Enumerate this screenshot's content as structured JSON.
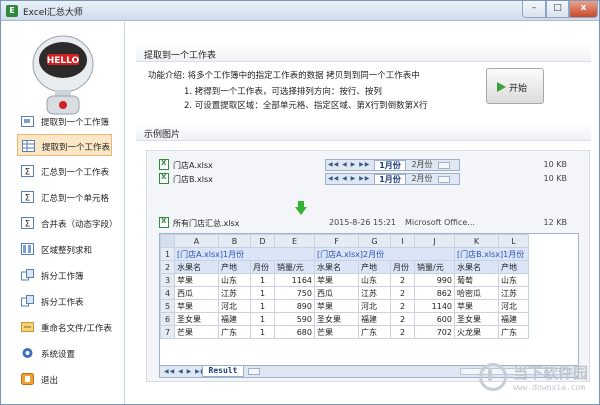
{
  "window": {
    "title": "Excel汇总大师",
    "icon": "excel-app-icon",
    "controls": {
      "minimize": "–",
      "maximize": "□",
      "close": "x"
    }
  },
  "sidebar": {
    "logo_text": "HELLO",
    "items": [
      {
        "label": "提取到一个工作簿",
        "icon": "extract-workbook-icon"
      },
      {
        "label": "提取到一个工作表",
        "icon": "extract-sheet-icon",
        "active": true
      },
      {
        "label": "汇总到一个工作表",
        "icon": "sum-sheet-icon"
      },
      {
        "label": "汇总到一个单元格",
        "icon": "sum-cell-icon"
      },
      {
        "label": "合并表（动态字段）",
        "icon": "merge-table-icon"
      },
      {
        "label": "区域整列求和",
        "icon": "column-sum-icon"
      },
      {
        "label": "拆分工作簿",
        "icon": "split-workbook-icon"
      },
      {
        "label": "拆分工作表",
        "icon": "split-sheet-icon"
      },
      {
        "label": "重命名文件/工作表",
        "icon": "rename-icon"
      },
      {
        "label": "系统设置",
        "icon": "settings-icon"
      },
      {
        "label": "退出",
        "icon": "exit-icon"
      }
    ]
  },
  "main": {
    "section_title": "提取到一个工作表",
    "intro": "功能介绍: 将多个工作簿中的指定工作表的数据 拷贝到到同一个工作表中",
    "point1": "1. 拷得到一个工作表，可选择排列方向：按行、按列",
    "point2": "2. 可设置提取区域：全部单元格、指定区域、第X行到倒数第X行",
    "start_button": "开始",
    "example_title": "示例图片"
  },
  "example": {
    "files": [
      {
        "name": "门店A.xlsx",
        "size": "10 KB",
        "tab_active": "1月份",
        "tab_other": "2月份"
      },
      {
        "name": "门店B.xlsx",
        "size": "10 KB",
        "tab_active": "1月份",
        "tab_other": "2月份"
      }
    ],
    "output": {
      "name": "所有门店汇总.xlsx",
      "date": "2015-8-26 15:21",
      "type": "Microsoft Office...",
      "size": "12 KB"
    },
    "sheet_tab": "Result",
    "nav_glyphs": "◀◀ ◀ ▶ ▶▶",
    "columns": [
      "",
      "A",
      "B",
      "D",
      "E",
      "F",
      "G",
      "I",
      "J",
      "K",
      "L"
    ],
    "source_row": [
      "[门店A.xlsx]1月份",
      "[门店A.xlsx]2月份",
      "[门店B.xlsx]1月份"
    ],
    "header_row": [
      "水果名",
      "产地",
      "月份",
      "销量/元",
      "水果名",
      "产地",
      "月份",
      "销量/元",
      "水果名",
      "产地"
    ],
    "rows": [
      {
        "n": "3",
        "cells": [
          "苹果",
          "山东",
          "1",
          "1164",
          "苹果",
          "山东",
          "2",
          "990",
          "葡萄",
          "山东"
        ]
      },
      {
        "n": "4",
        "cells": [
          "西瓜",
          "江苏",
          "1",
          "750",
          "西瓜",
          "江苏",
          "2",
          "862",
          "哈密瓜",
          "江苏"
        ]
      },
      {
        "n": "5",
        "cells": [
          "苹果",
          "河北",
          "1",
          "890",
          "苹果",
          "河北",
          "2",
          "1140",
          "苹果",
          "河北"
        ]
      },
      {
        "n": "6",
        "cells": [
          "圣女果",
          "福建",
          "1",
          "590",
          "圣女果",
          "福建",
          "2",
          "600",
          "圣女果",
          "福建"
        ]
      },
      {
        "n": "7",
        "cells": [
          "芒果",
          "广东",
          "1",
          "680",
          "芒果",
          "广东",
          "2",
          "702",
          "火龙果",
          "广东"
        ]
      }
    ]
  },
  "watermark": {
    "text": "当下软件园",
    "url": "www.downxia.com"
  }
}
